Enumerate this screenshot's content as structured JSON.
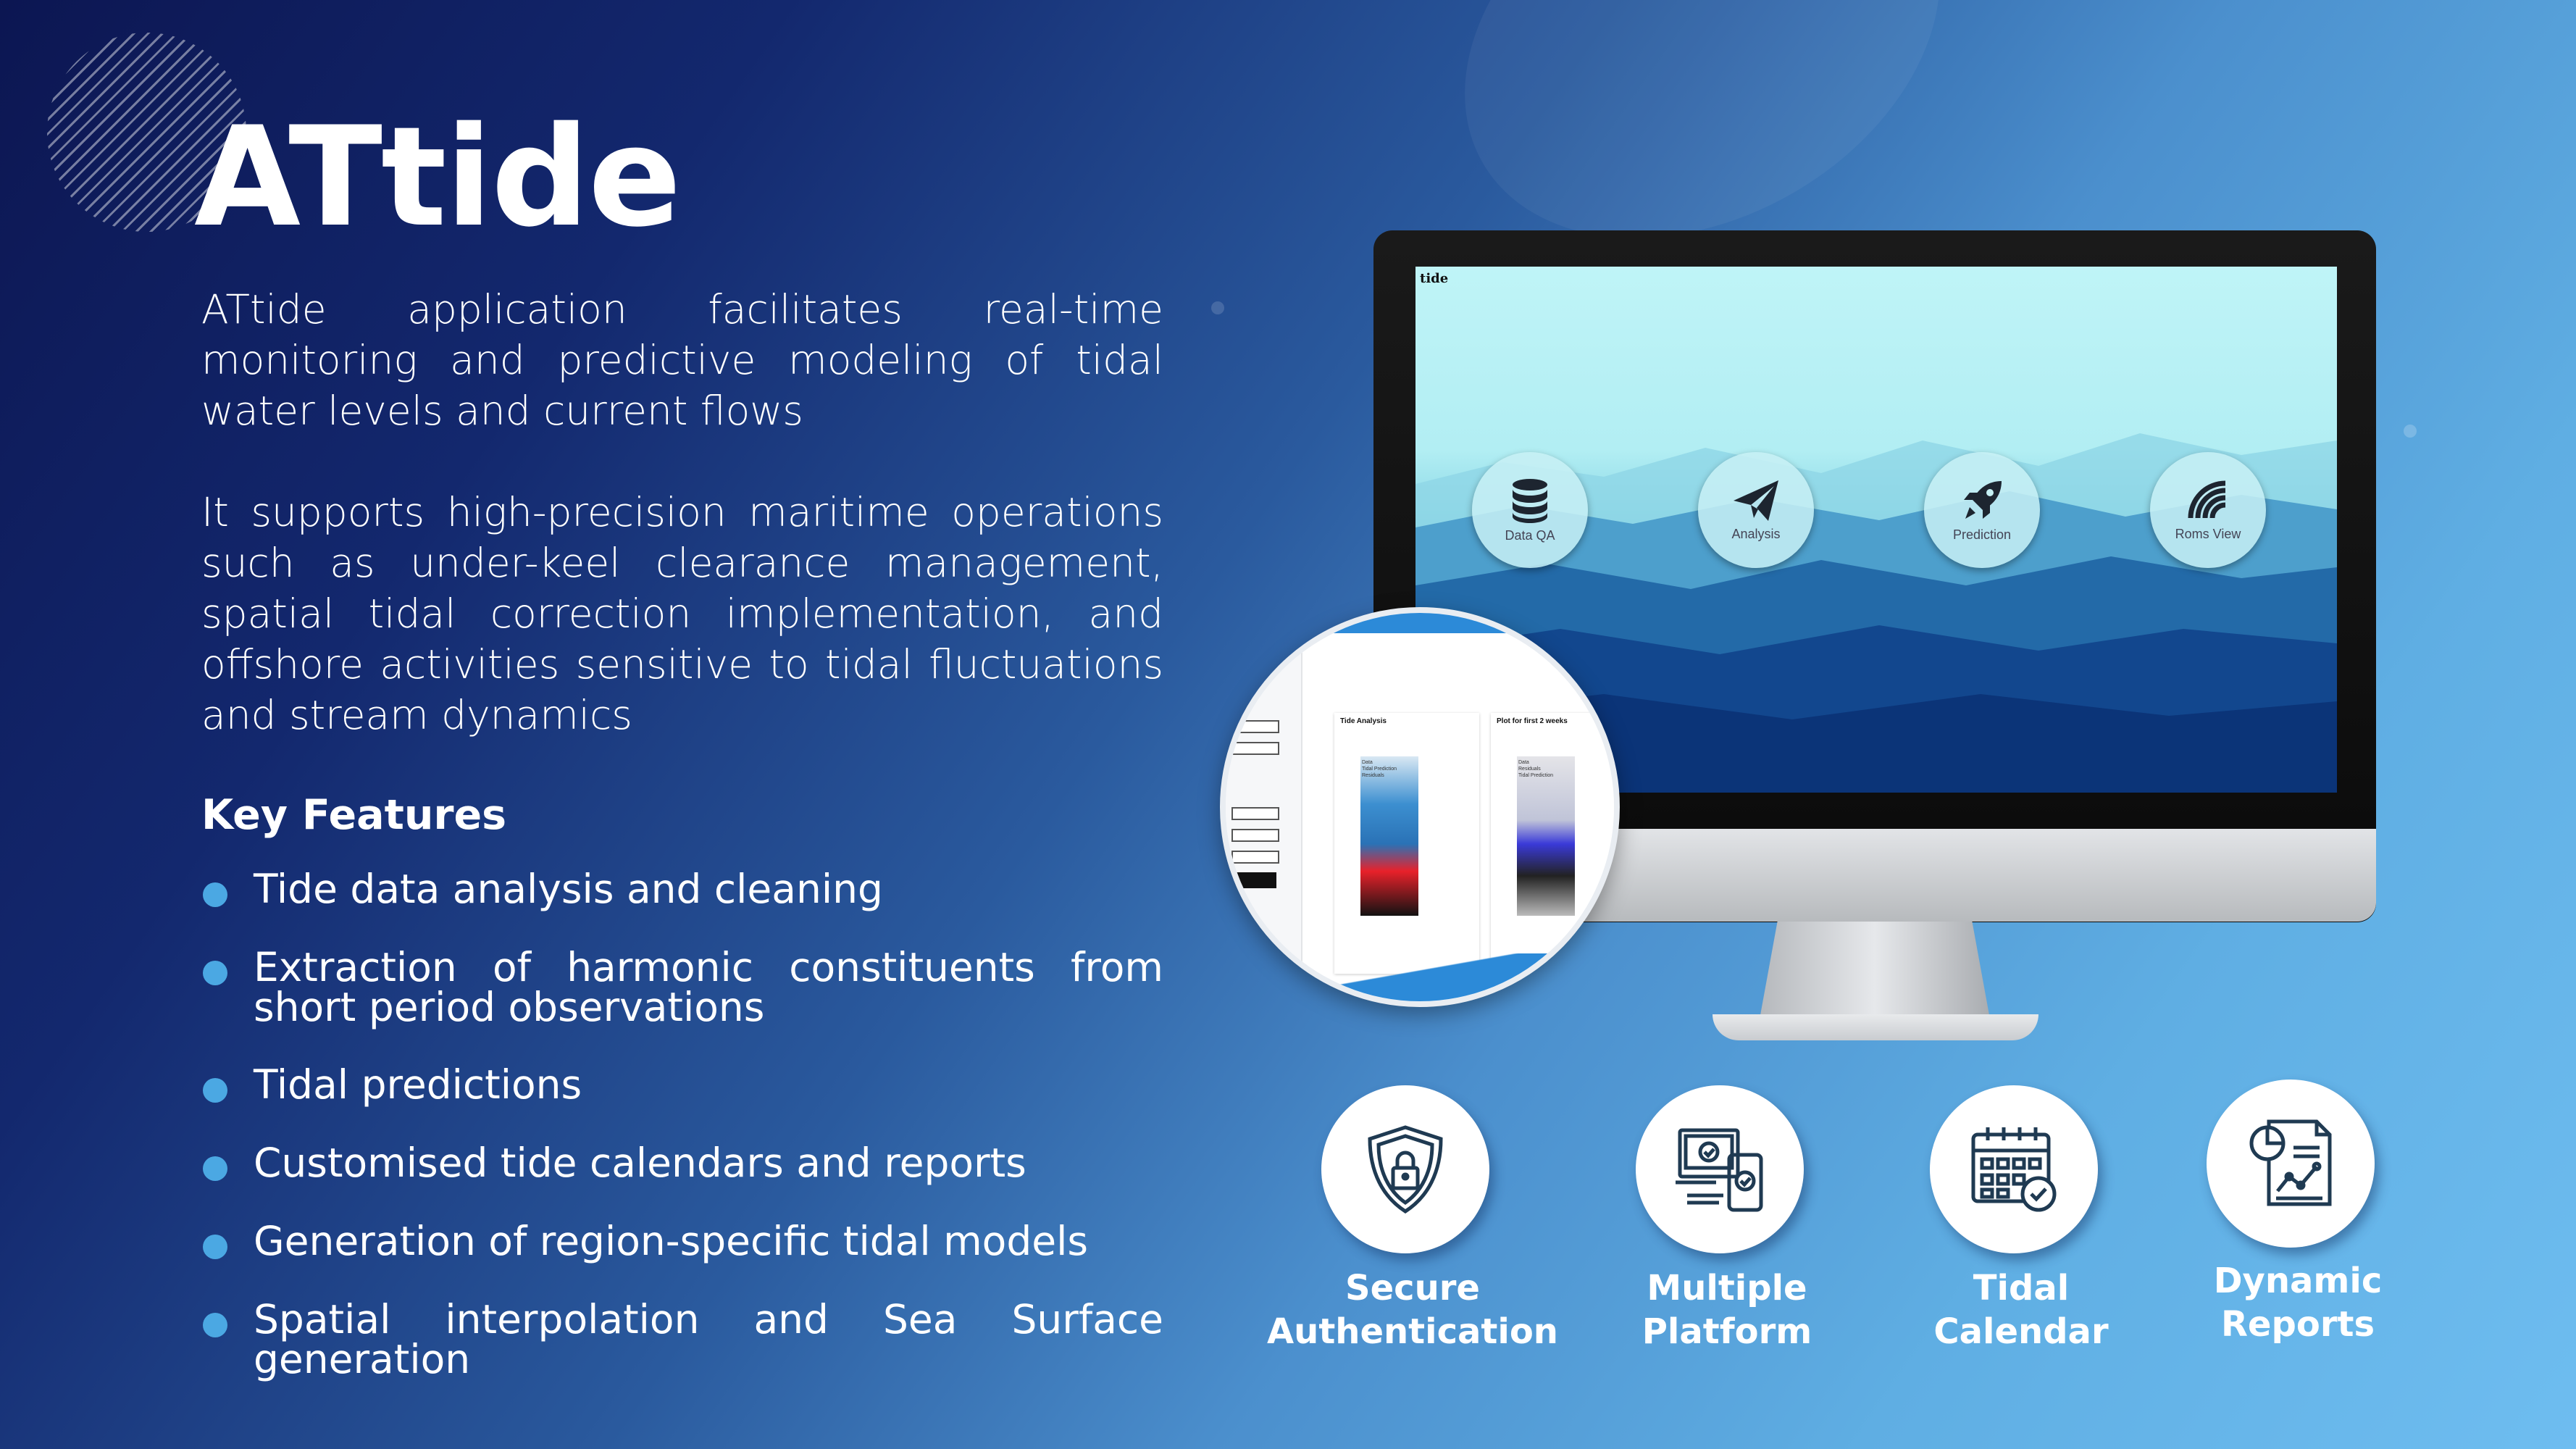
{
  "title": "ATtide",
  "intro": "ATtide application facilitates real-time monitoring and predictive modeling of tidal water levels and current flows",
  "support": "It supports high-precision maritime operations such as under-keel clearance management, spatial tidal correction implementation, and offshore activities sensitive to tidal fluctuations and stream dynamics",
  "key_features_title": "Key Features",
  "features": [
    "Tide data analysis and cleaning",
    "Extraction of harmonic constituents from short period observations",
    "Tidal predictions",
    "Customised tide calendars and reports",
    "Generation of region-specific tidal models",
    "Spatial interpolation and Sea Surface generation"
  ],
  "screen": {
    "logo": "tide",
    "buttons": [
      {
        "label": "Data QA",
        "icon": "database-icon"
      },
      {
        "label": "Analysis",
        "icon": "paper-plane-icon"
      },
      {
        "label": "Prediction",
        "icon": "rocket-icon"
      },
      {
        "label": "Roms View",
        "icon": "signal-icon"
      }
    ]
  },
  "magnifier": {
    "panel1_title": "Tide Analysis",
    "panel2_title": "Plot for first 2 weeks",
    "legend1": [
      "Data",
      "Tidal Prediction",
      "Residuals"
    ],
    "legend2": [
      "Data",
      "Residuals",
      "Tidal Prediction"
    ]
  },
  "bottom_features": [
    {
      "label_line1": "Secure",
      "label_line2": "Authentication",
      "icon": "shield-lock-icon"
    },
    {
      "label_line1": "Multiple",
      "label_line2": "Platform",
      "icon": "devices-icon"
    },
    {
      "label_line1": "Tidal",
      "label_line2": "Calendar",
      "icon": "calendar-check-icon"
    },
    {
      "label_line1": "Dynamic",
      "label_line2": "Reports",
      "icon": "report-chart-icon"
    }
  ],
  "colors": {
    "bg_dark": "#0c1652",
    "bg_light": "#6ebdf0",
    "bullet": "#4ba8e3",
    "icon_stroke": "#1f3a52"
  }
}
